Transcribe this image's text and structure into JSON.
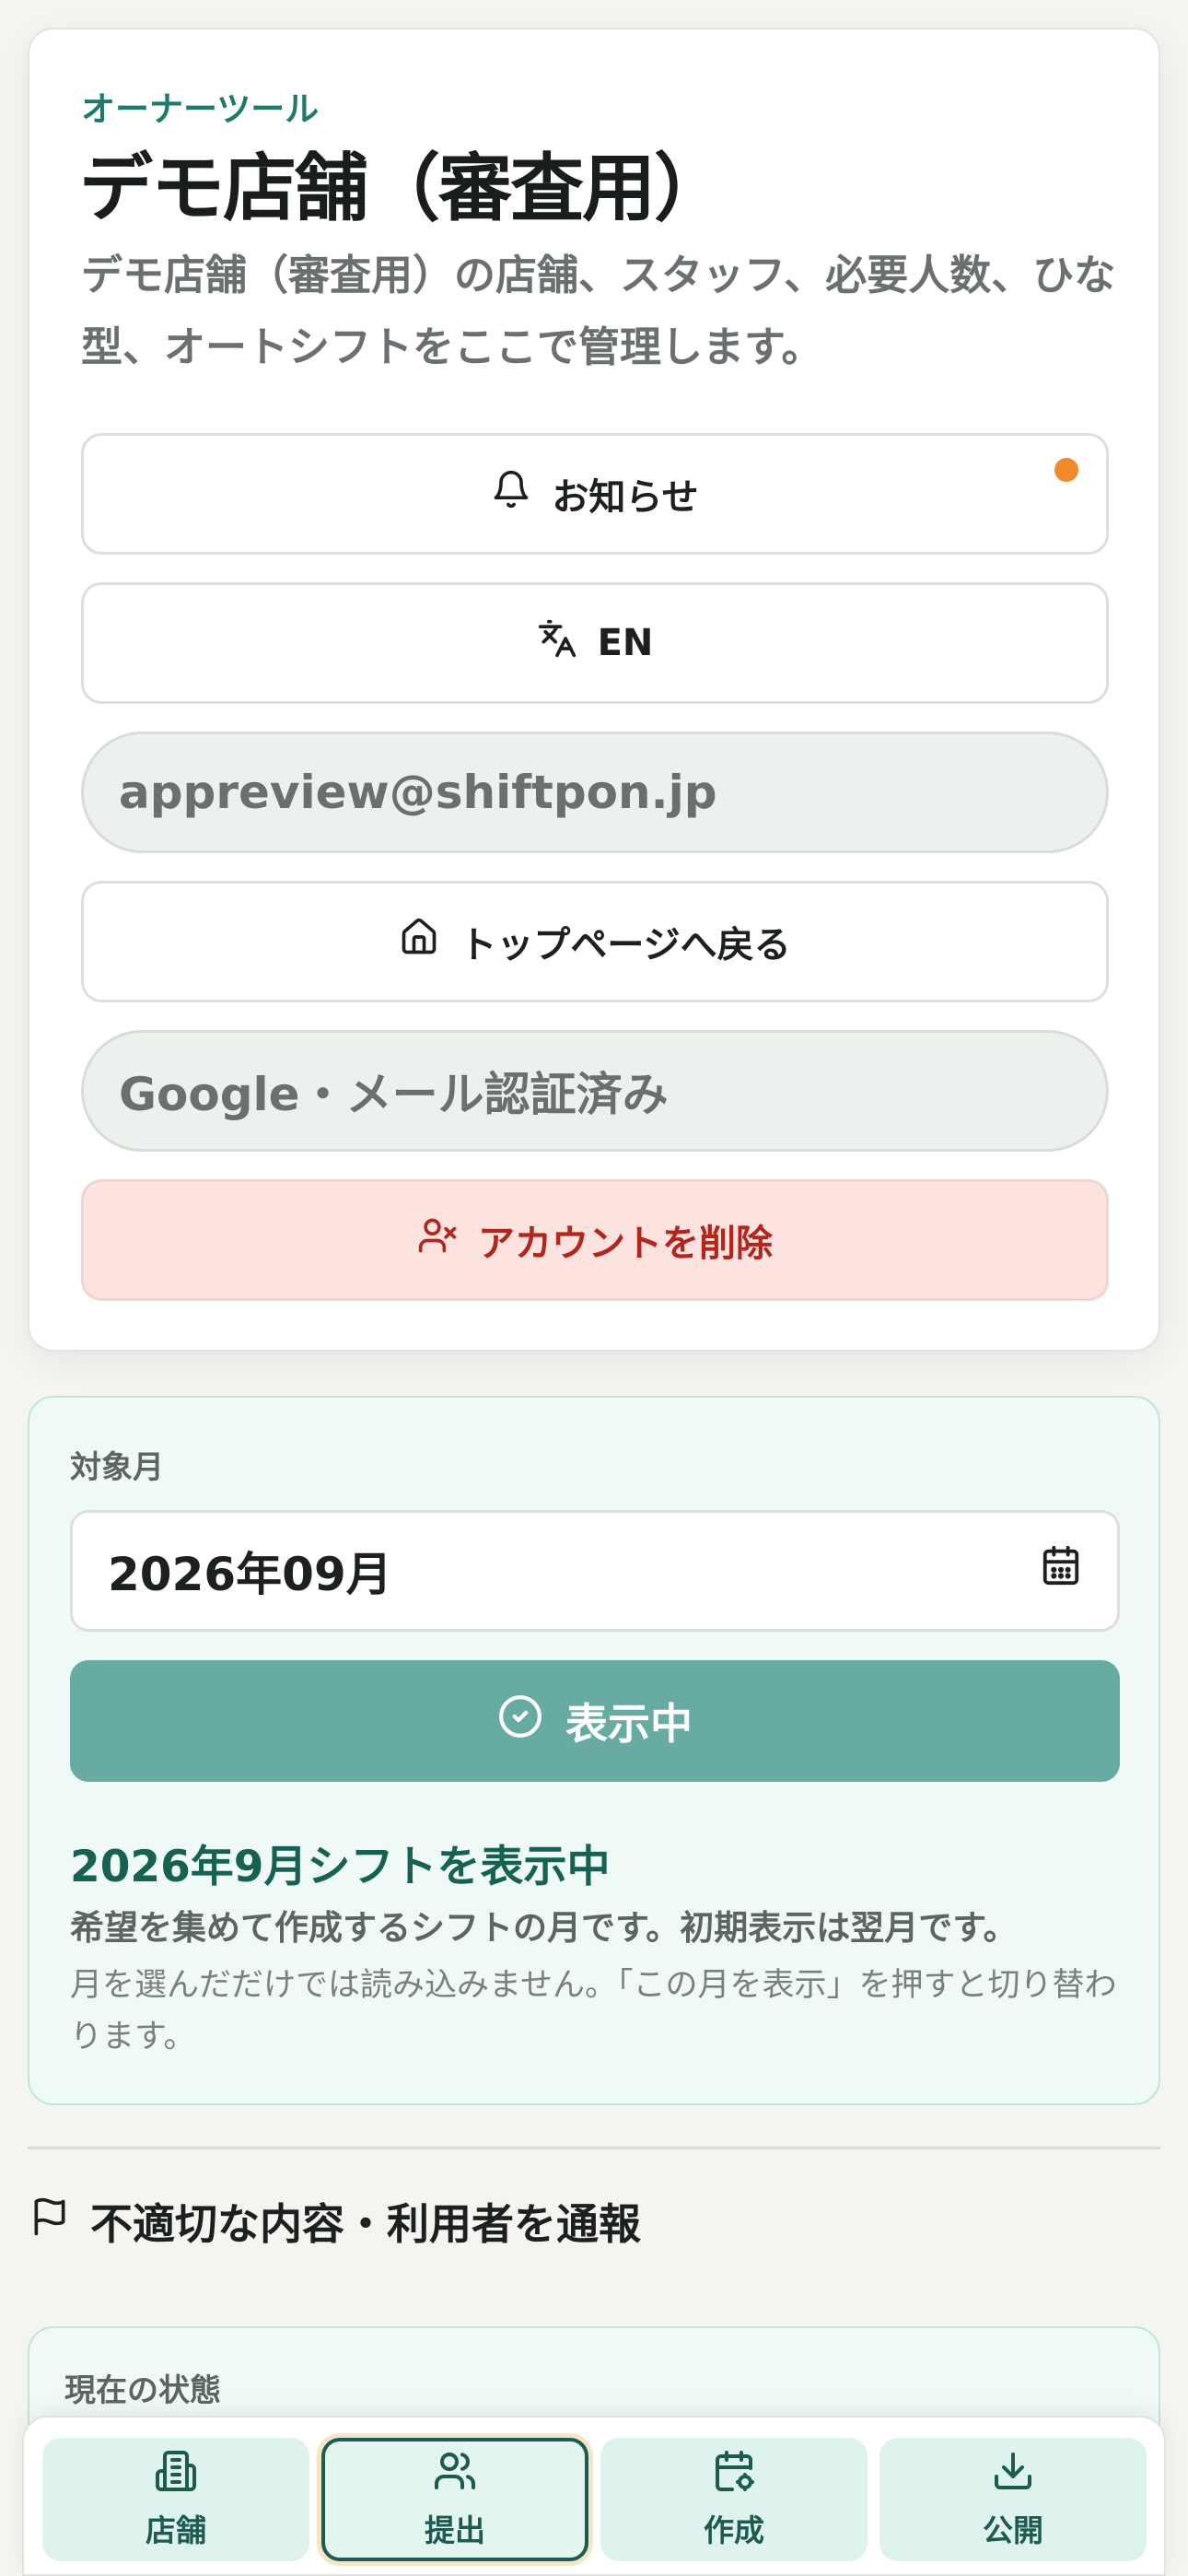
{
  "owner": {
    "eyebrow": "オーナーツール",
    "title": "デモ店舗（審査用）",
    "subtitle": "デモ店舗（審査用）の店舗、スタッフ、必要人数、ひな型、オートシフトをここで管理します。",
    "notifications_label": "お知らせ",
    "notifications_unread": true,
    "language_label": "EN",
    "email": "appreview@shiftpon.jp",
    "back_to_top_label": "トップページへ戻る",
    "auth_status": "Google・メール認証済み",
    "delete_account_label": "アカウントを削除"
  },
  "month_selector": {
    "label": "対象月",
    "value": "2026年09月",
    "button_label": "表示中",
    "heading": "2026年9月シフトを表示中",
    "description": "希望を集めて作成するシフトの月です。初期表示は翌月です。",
    "note": "月を選んだだけでは読み込みません。「この月を表示」を押すと切り替わります。"
  },
  "report": {
    "label": "不適切な内容・利用者を通報"
  },
  "status": {
    "label": "現在の状態"
  },
  "bottom_nav": {
    "items": [
      {
        "label": "店舗",
        "icon": "building-icon",
        "active": false
      },
      {
        "label": "提出",
        "icon": "users-icon",
        "active": true
      },
      {
        "label": "作成",
        "icon": "calendar-cog-icon",
        "active": false
      },
      {
        "label": "公開",
        "icon": "download-icon",
        "active": false
      }
    ]
  },
  "colors": {
    "accent": "#1f7a6c",
    "primary_button": "#67aba3",
    "danger_bg": "#fde3df",
    "danger_text": "#b2261e",
    "notification_dot": "#f08a2c",
    "panel_bg": "#effaf6"
  }
}
